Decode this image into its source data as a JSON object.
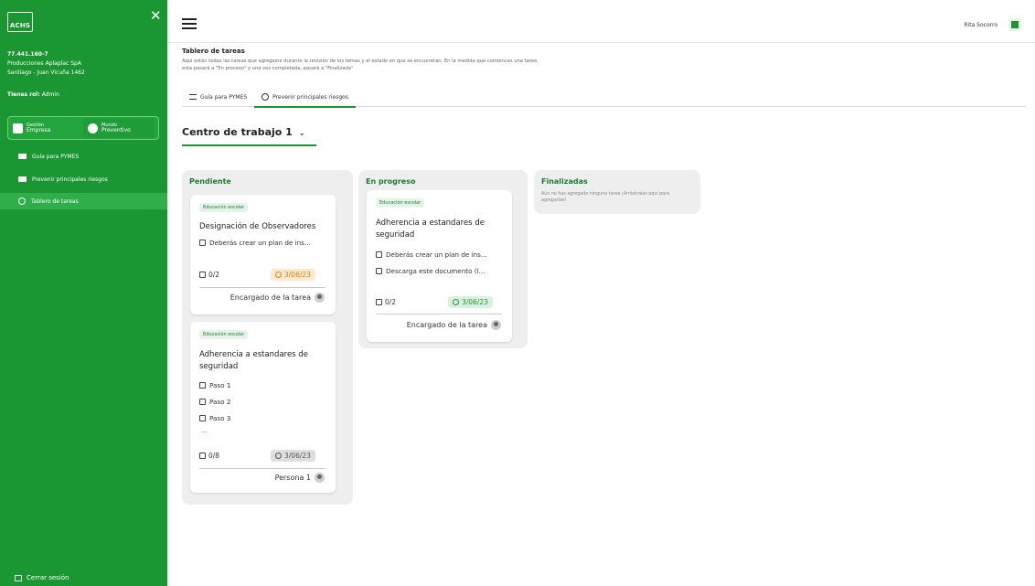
{
  "sidebar": {
    "logo": "ACHS",
    "close": "✕",
    "company": {
      "rut": "77.441.160-7",
      "name": "Producciones Aplaplac SpA",
      "address": "Santiago - Juan Vicuña 1462"
    },
    "role_label": "Tienes rol:",
    "role_value": "Admin",
    "modes": [
      {
        "small": "Gestión",
        "label": "Empresa"
      },
      {
        "small": "Mundo",
        "label": "Preventivo"
      }
    ],
    "nav": [
      {
        "label": "Guía para PYMES"
      },
      {
        "label": "Prevenir principales riesgos"
      },
      {
        "label": "Tablero de tareas"
      }
    ],
    "logout": "Cerrar sesión"
  },
  "topbar": {
    "user": "Rita Socorro"
  },
  "header": {
    "title": "Tablero de tareas",
    "description": "Aquí están todas las tareas que agregaste durante la revisión de los temas y el estado en que se encuentran. En la medida que comiences una tarea, esta pasará a \"En proceso\" y una vez completada, pasará a \"Finalizada\""
  },
  "tabs": [
    {
      "label": "Guía para PYMES"
    },
    {
      "label": "Prevenir principales riesgos"
    }
  ],
  "centro": {
    "label": "Centro de trabajo 1",
    "chevron": "⌄"
  },
  "columns": {
    "pendiente": {
      "title": "Pendiente",
      "cards": [
        {
          "badge": "Educación escolar",
          "title": "Designación de Observadores",
          "subtasks": [
            "Deberás crear un plan de ins..."
          ],
          "count": "0/2",
          "date": "3/06/23",
          "owner": "Encargado de la tarea"
        },
        {
          "badge": "Educación escolar",
          "title": "Adherencia a estandares de seguridad",
          "subtasks": [
            "Paso 1",
            "Paso 2",
            "Paso 3"
          ],
          "more": "...",
          "count": "0/8",
          "date": "3/06/23",
          "owner": "Persona 1"
        }
      ]
    },
    "progreso": {
      "title": "En progreso",
      "cards": [
        {
          "badge": "Educación escolar",
          "title": "Adherencia a estandares de seguridad",
          "subtasks": [
            "Deberás crear un plan de ins...",
            "Descarga este documento (l..."
          ],
          "count": "0/2",
          "date": "3/06/23",
          "owner": "Encargado de la tarea"
        }
      ]
    },
    "finalizadas": {
      "title": "Finalizadas",
      "empty": "Aún no has agregado ninguna tarea ¡Arrástralas aquí para agregarlas!"
    }
  },
  "colors": {
    "brand": "#1a9632",
    "date_warning": "#e3820f",
    "date_ok": "#1a9632",
    "date_neutral": "#555555"
  }
}
